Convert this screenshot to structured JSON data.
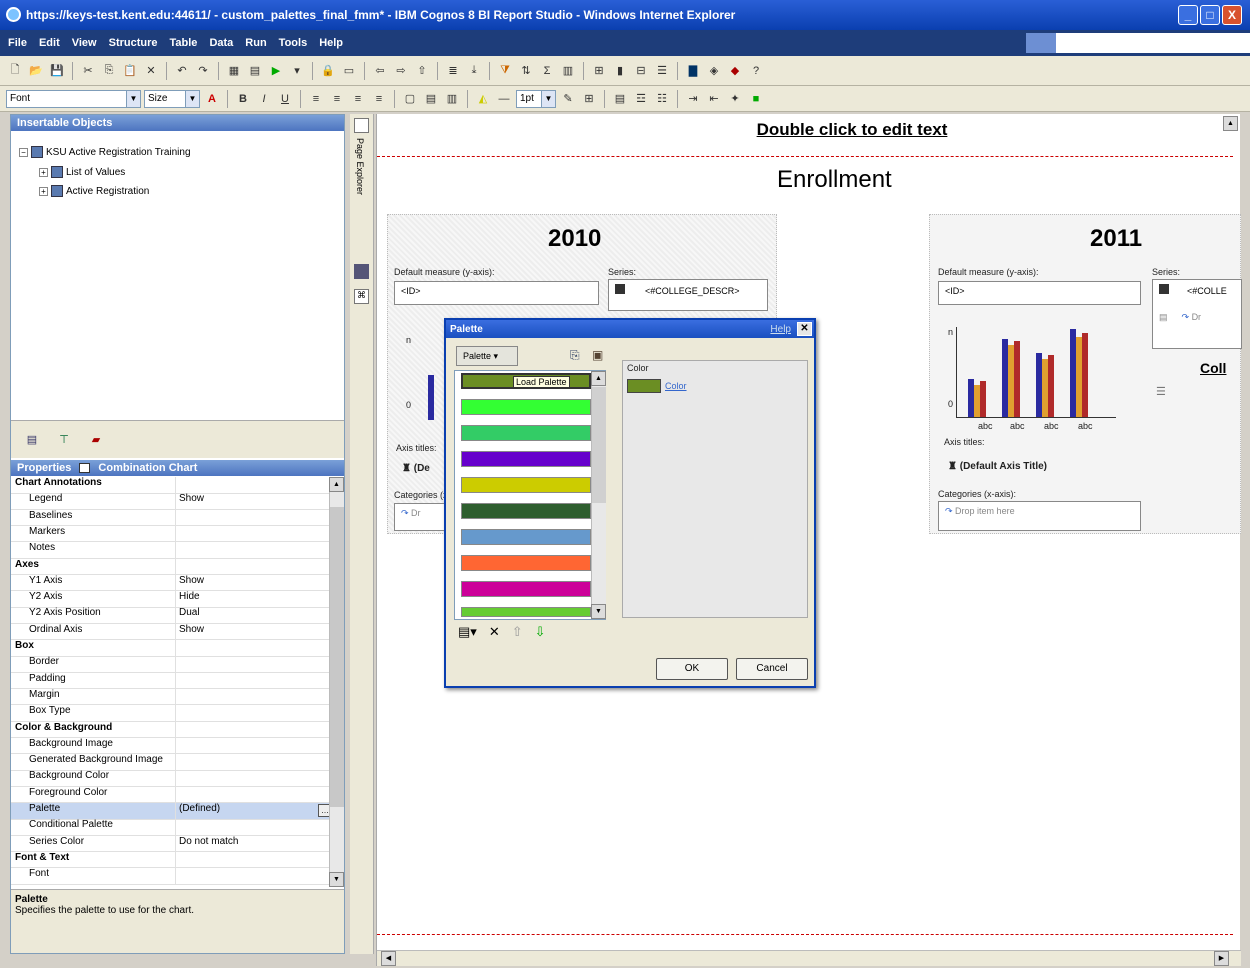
{
  "window": {
    "title": "https://keys-test.kent.edu:44611/ - custom_palettes_final_fmm* - IBM Cognos 8 BI Report Studio - Windows Internet Explorer",
    "controls": [
      "_",
      "□",
      "X"
    ]
  },
  "menu": [
    "File",
    "Edit",
    "View",
    "Structure",
    "Table",
    "Data",
    "Run",
    "Tools",
    "Help"
  ],
  "format_bar": {
    "font_value": "Font",
    "size_value": "Size",
    "border_width": "1pt"
  },
  "insertable_objects": {
    "header": "Insertable Objects",
    "root": "KSU Active Registration Training",
    "children": [
      "List of Values",
      "Active Registration"
    ]
  },
  "properties": {
    "header_label": "Properties",
    "header_object": "Combination Chart",
    "rows": [
      {
        "name": "Chart Annotations",
        "value": "",
        "cat": true
      },
      {
        "name": "Legend",
        "value": "Show"
      },
      {
        "name": "Baselines",
        "value": ""
      },
      {
        "name": "Markers",
        "value": ""
      },
      {
        "name": "Notes",
        "value": ""
      },
      {
        "name": "Axes",
        "value": "",
        "cat": true
      },
      {
        "name": "Y1 Axis",
        "value": "Show"
      },
      {
        "name": "Y2 Axis",
        "value": "Hide"
      },
      {
        "name": "Y2 Axis Position",
        "value": "Dual"
      },
      {
        "name": "Ordinal Axis",
        "value": "Show"
      },
      {
        "name": "Box",
        "value": "",
        "cat": true
      },
      {
        "name": "Border",
        "value": ""
      },
      {
        "name": "Padding",
        "value": ""
      },
      {
        "name": "Margin",
        "value": ""
      },
      {
        "name": "Box Type",
        "value": ""
      },
      {
        "name": "Color & Background",
        "value": "",
        "cat": true
      },
      {
        "name": "Background Image",
        "value": ""
      },
      {
        "name": "Generated Background Image",
        "value": ""
      },
      {
        "name": "Background Color",
        "value": ""
      },
      {
        "name": "Foreground Color",
        "value": ""
      },
      {
        "name": "Palette",
        "value": "(Defined)",
        "sel": true
      },
      {
        "name": "Conditional Palette",
        "value": ""
      },
      {
        "name": "Series Color",
        "value": "Do not match"
      },
      {
        "name": "Font & Text",
        "value": "",
        "cat": true
      },
      {
        "name": "Font",
        "value": ""
      }
    ],
    "help_title": "Palette",
    "help_text": "Specifies the palette to use for the chart."
  },
  "page_explorer_label": "Page Explorer",
  "report": {
    "header_text": "Double click to edit text",
    "title": "Enrollment",
    "year_left": "2010",
    "year_right": "2011",
    "default_measure_label": "Default measure (y-axis):",
    "measure_value": "<ID>",
    "series_label": "Series:",
    "series_item": "<#COLLEGE_DESCR>",
    "series_item_right": "<#COLLE",
    "axis_titles": "Axis titles:",
    "default_axis_title": "(Default Axis Title)",
    "axis_title_clipped": "(De",
    "categories_label": "Categories (x-axis):",
    "drop_item_here": "Drop item here",
    "drop_item_clipped": "Dr",
    "col_clipped": "Coll",
    "x_tick_labels": [
      "abc",
      "abc",
      "abc",
      "abc"
    ],
    "y_tick_n": "n",
    "y_tick_0": "0"
  },
  "palette_dialog": {
    "title": "Palette",
    "help_link": "Help",
    "dropdown": "Palette",
    "tooltip": "Load Palette",
    "color_section_label": "Color",
    "color_value": "Color",
    "swatches": [
      "#6b8e23",
      "#33ff33",
      "#33cc66",
      "#6600cc",
      "#cccc00",
      "#2e5e2e",
      "#6699cc",
      "#ff6633",
      "#cc0099",
      "#66cc33"
    ],
    "ok": "OK",
    "cancel": "Cancel"
  },
  "chart_colors": {
    "blue": "#2a2aa0",
    "orange": "#e0a030",
    "red": "#b02a2a"
  }
}
